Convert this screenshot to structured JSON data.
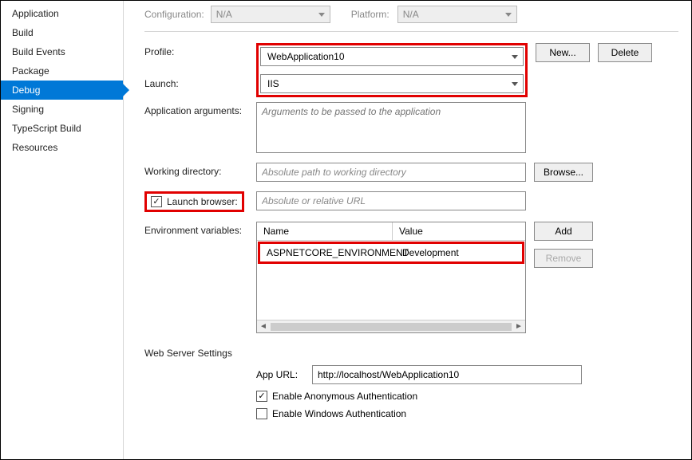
{
  "nav": {
    "items": [
      {
        "label": "Application"
      },
      {
        "label": "Build"
      },
      {
        "label": "Build Events"
      },
      {
        "label": "Package"
      },
      {
        "label": "Debug"
      },
      {
        "label": "Signing"
      },
      {
        "label": "TypeScript Build"
      },
      {
        "label": "Resources"
      }
    ],
    "active": "Debug"
  },
  "config_bar": {
    "configuration_label": "Configuration:",
    "configuration_value": "N/A",
    "platform_label": "Platform:",
    "platform_value": "N/A"
  },
  "profile": {
    "label": "Profile:",
    "value": "WebApplication10",
    "new_button": "New...",
    "delete_button": "Delete"
  },
  "launch": {
    "label": "Launch:",
    "value": "IIS"
  },
  "app_args": {
    "label": "Application arguments:",
    "placeholder": "Arguments to be passed to the application"
  },
  "workdir": {
    "label": "Working directory:",
    "placeholder": "Absolute path to working directory",
    "browse": "Browse..."
  },
  "launch_browser": {
    "label": "Launch browser:",
    "checked": true,
    "placeholder": "Absolute or relative URL"
  },
  "env": {
    "label": "Environment variables:",
    "col_name": "Name",
    "col_value": "Value",
    "rows": [
      {
        "name": "ASPNETCORE_ENVIRONMENT",
        "value": "Development"
      }
    ],
    "add": "Add",
    "remove": "Remove"
  },
  "webserver": {
    "heading": "Web Server Settings",
    "appurl_label": "App URL:",
    "appurl_value": "http://localhost/WebApplication10",
    "anon_label": "Enable Anonymous Authentication",
    "anon_checked": true,
    "win_label": "Enable Windows Authentication",
    "win_checked": false
  }
}
